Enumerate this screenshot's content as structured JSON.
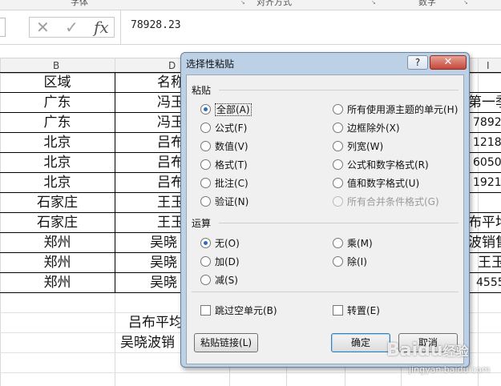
{
  "ribbon": {
    "groups": [
      "字体",
      "对齐方式",
      "数字"
    ]
  },
  "formula_bar": {
    "icons": [
      "cancel-icon",
      "enter-icon",
      "insert-function-icon"
    ],
    "fx_label": "fx",
    "value": "78928.23"
  },
  "columns": [
    "B",
    "D",
    "I"
  ],
  "sheet": {
    "col_b": [
      "区域",
      "广东",
      "广东",
      "北京",
      "北京",
      "北京",
      "石家庄",
      "石家庄",
      "郑州",
      "郑州",
      "郑州"
    ],
    "col_d": [
      "名称",
      "冯玉",
      "冯玉",
      "吕布",
      "吕布",
      "吕布",
      "王玉",
      "王玉",
      "吴晓",
      "吴晓",
      "吴晓"
    ],
    "col_right": [
      "第一季",
      "7892",
      "1218",
      "6050",
      "1921",
      "",
      "布平均",
      "波销售",
      "王玉",
      "4555"
    ],
    "extra_rows": [
      "吕布平均",
      "吴晓波销"
    ]
  },
  "dialog": {
    "title": "选择性粘贴",
    "help": "?",
    "close": "✕",
    "paste_group": "粘贴",
    "paste_left": [
      "全部(A)",
      "公式(F)",
      "数值(V)",
      "格式(T)",
      "批注(C)",
      "验证(N)"
    ],
    "paste_right": [
      "所有使用源主题的单元(H)",
      "边框除外(X)",
      "列宽(W)",
      "公式和数字格式(R)",
      "值和数字格式(U)",
      "所有合并条件格式(G)"
    ],
    "operation_group": "运算",
    "op_left": [
      "无(O)",
      "加(D)",
      "减(S)"
    ],
    "op_right": [
      "乘(M)",
      "除(I)"
    ],
    "skip_blanks": "跳过空单元(B)",
    "transpose": "转置(E)",
    "paste_link": "粘贴链接(L)",
    "ok": "确定",
    "cancel": "取消"
  },
  "watermark": {
    "brand": "Baidu",
    "brand_suffix": "经验",
    "url": "jingyan.baidu.com"
  }
}
